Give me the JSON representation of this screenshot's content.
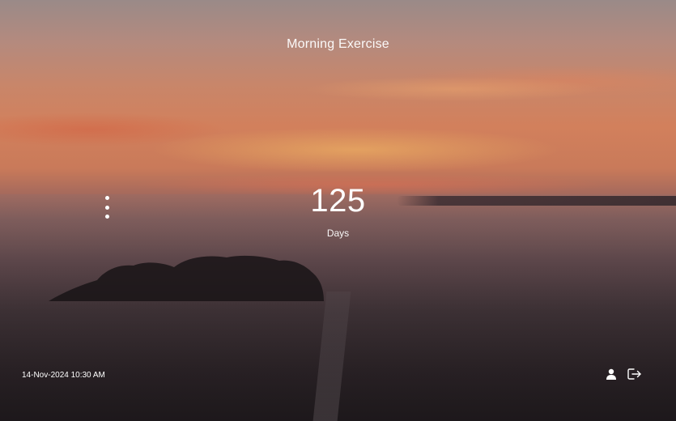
{
  "app": {
    "title": "Morning Exercise"
  },
  "counter": {
    "value": "125",
    "unit": "Days"
  },
  "footer": {
    "datetime": "14-Nov-2024 10:30 AM"
  },
  "icons": {
    "menu": "more-vertical-icon",
    "user": "user-icon",
    "logout": "logout-icon"
  },
  "colors": {
    "text": "#ffffff"
  }
}
